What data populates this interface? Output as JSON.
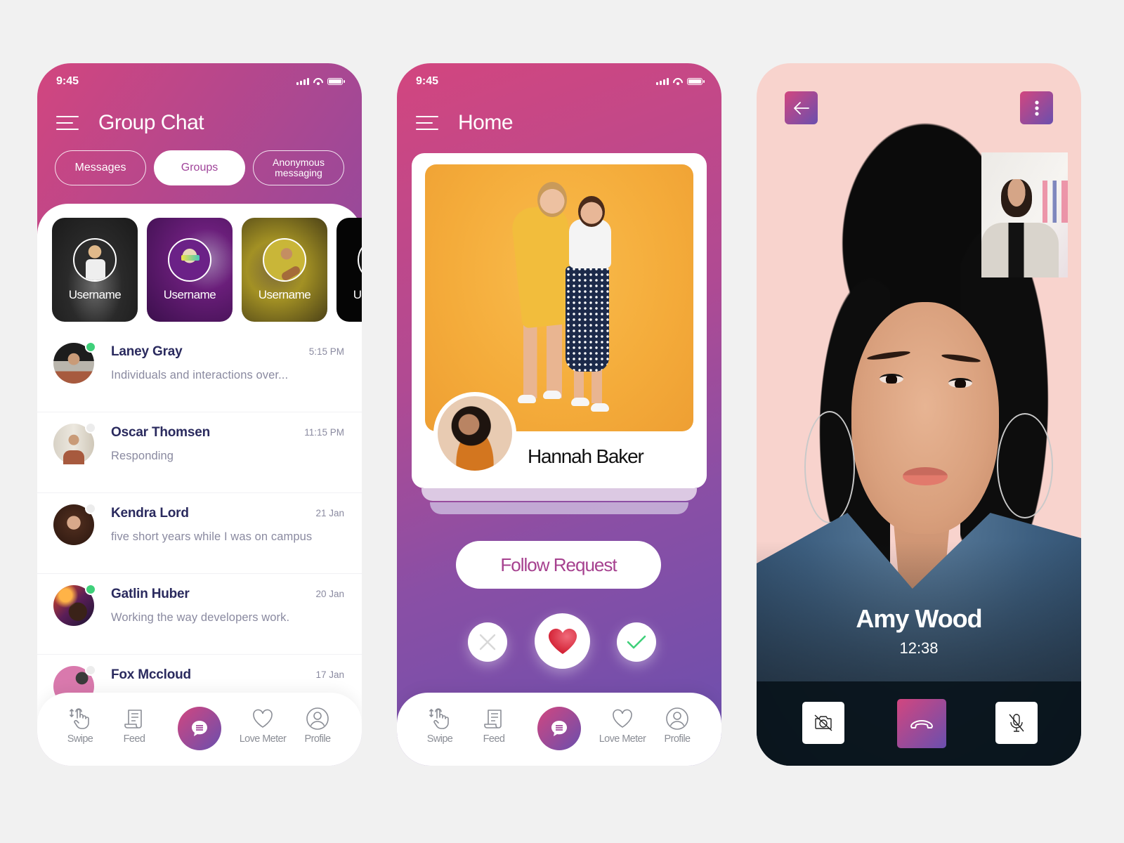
{
  "colors": {
    "gradient_start": "#d2467f",
    "gradient_end": "#6a4fae",
    "online": "#3fd07a",
    "name_text": "#2a2a5e",
    "muted_text": "#8a8aa0",
    "nav_icon": "#8b8e96",
    "accent_text": "#a6418f",
    "heart": "#e02b3c"
  },
  "group_chat_screen": {
    "status_time": "9:45",
    "title": "Group Chat",
    "menu_icon": "hamburger-icon",
    "tabs": [
      {
        "label": "Messages",
        "active": false
      },
      {
        "label": "Groups",
        "active": true
      },
      {
        "label": "Anonymous messaging",
        "active": false
      }
    ],
    "stories": [
      {
        "username": "Username"
      },
      {
        "username": "Username"
      },
      {
        "username": "Username"
      },
      {
        "username": "Username"
      }
    ],
    "chats": [
      {
        "name": "Laney Gray",
        "preview": "Individuals and interactions over...",
        "time": "5:15 PM",
        "online": true
      },
      {
        "name": "Oscar Thomsen",
        "preview": "Responding",
        "time": "11:15 PM",
        "online": false
      },
      {
        "name": "Kendra Lord",
        "preview": "five short years while I was on campus",
        "time": "21 Jan",
        "online": false
      },
      {
        "name": "Gatlin Huber",
        "preview": "Working the way developers work.",
        "time": "20 Jan",
        "online": true
      },
      {
        "name": "Fox Mccloud",
        "preview": "",
        "time": "17 Jan",
        "online": false
      }
    ]
  },
  "home_screen": {
    "status_time": "9:45",
    "title": "Home",
    "menu_icon": "hamburger-icon",
    "profile_name": "Hannah Baker",
    "follow_button": "Follow Request",
    "actions": [
      {
        "name": "reject",
        "icon": "close-icon"
      },
      {
        "name": "like",
        "icon": "heart-icon"
      },
      {
        "name": "accept",
        "icon": "check-icon"
      }
    ]
  },
  "bottom_nav": {
    "items": [
      {
        "label": "Swipe",
        "icon": "swipe-hand-icon"
      },
      {
        "label": "Feed",
        "icon": "feed-scroll-icon"
      },
      {
        "label": "",
        "icon": "chat-bubble-icon",
        "active": true
      },
      {
        "label": "Love Meter",
        "icon": "heart-outline-icon"
      },
      {
        "label": "Profile",
        "icon": "user-circle-icon"
      }
    ]
  },
  "video_call_screen": {
    "caller_name": "Amy Wood",
    "call_duration": "12:38",
    "back_icon": "arrow-left-icon",
    "more_icon": "more-vertical-icon",
    "controls": [
      {
        "name": "camera-off",
        "icon": "camera-off-icon"
      },
      {
        "name": "end-call",
        "icon": "phone-hangup-icon"
      },
      {
        "name": "mute",
        "icon": "mic-off-icon"
      }
    ]
  }
}
